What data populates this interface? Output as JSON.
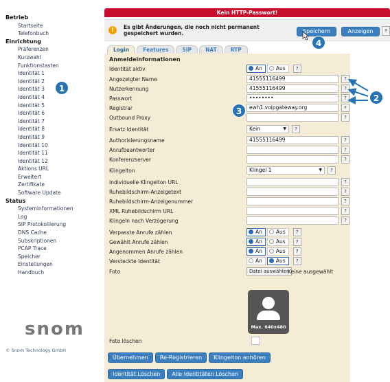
{
  "sidebar": {
    "sections": [
      {
        "title": "Betrieb",
        "items": [
          "Startseite",
          "Telefonbuch"
        ]
      },
      {
        "title": "Einrichtung",
        "items": [
          "Präferenzen",
          "Kurzwahl",
          "Funktionstasten",
          "Identität 1",
          "Identität 2",
          "Identität 3",
          "Identität 4",
          "Identität 5",
          "Identität 6",
          "Identität 7",
          "Identität 8",
          "Identität 9",
          "Identität 10",
          "Identität 11",
          "Identität 12",
          "Aktions URL",
          "Erweitert",
          "Zertifikate",
          "Software Update"
        ]
      },
      {
        "title": "Status",
        "items": [
          "Systeminformationen",
          "Log",
          "SIP Protokollierung",
          "DNS Cache",
          "Subskriptionen",
          "PCAP Trace",
          "Speicher",
          "Einstellungen",
          "Handbuch"
        ]
      }
    ],
    "logo": "snom",
    "copyright": "© Snom Technology GmbH"
  },
  "banner": "Kein HTTP-Passwort!",
  "notice": {
    "icon": "warning-icon",
    "text": "Es gibt Änderungen, die noch nicht permanent gespeichert wurden.",
    "save_label": "Speichern",
    "view_label": "Anzeigen",
    "help": "?"
  },
  "tabs": [
    "Login",
    "Features",
    "SIP",
    "NAT",
    "RTP"
  ],
  "active_tab": "Login",
  "form": {
    "section_title": "Anmeldeinformationen",
    "fields": {
      "identitaet_aktiv": {
        "label": "Identität aktiv",
        "on": "An",
        "off": "Aus",
        "selected": "An"
      },
      "angezeigter_name": {
        "label": "Angezeigter Name",
        "value": "41555116499"
      },
      "nutzerkennung": {
        "label": "Nutzerkennung",
        "value": "41555116499"
      },
      "passwort": {
        "label": "Passwort",
        "value": "••••••••"
      },
      "registrar": {
        "label": "Registrar",
        "value": "ewh1.voipgateway.org"
      },
      "outbound_proxy": {
        "label": "Outbound Proxy",
        "value": ""
      },
      "ersatz_identitaet": {
        "label": "Ersatz Identität",
        "value": "Kein"
      },
      "authorisierungsname": {
        "label": "Authorisierungsname",
        "value": "41555116499"
      },
      "anrufbeantworter": {
        "label": "Anrufbeantworter",
        "value": ""
      },
      "konferenzserver": {
        "label": "Konferenzserver",
        "value": ""
      },
      "klingelton": {
        "label": "Klingelton",
        "value": "Klingel 1"
      },
      "indiv_klingelton_url": {
        "label": "Individuelle Klingelton URL",
        "value": ""
      },
      "ruhebild_anzeigetext": {
        "label": "Ruhebildschirm-Anzeigetext",
        "value": ""
      },
      "ruhebild_anzeigenummer": {
        "label": "Ruhebildschirm-Anzeigenummer",
        "value": ""
      },
      "xml_ruhebild_url": {
        "label": "XML Ruhebildschirm URL",
        "value": ""
      },
      "klingeln_verzoegerung": {
        "label": "Klingeln nach Verzögerung",
        "value": ""
      },
      "verpasste_anrufe": {
        "label": "Verpasste Anrufe zählen",
        "on": "An",
        "off": "Aus",
        "selected": "An"
      },
      "gewaehlt_anrufe": {
        "label": "Gewählt Anrufe zählen",
        "on": "An",
        "off": "Aus",
        "selected": "An"
      },
      "angenommen_anrufe": {
        "label": "Angenommen Anrufe zählen",
        "on": "An",
        "off": "Aus",
        "selected": "An"
      },
      "versteckte_identitaet": {
        "label": "Versteckte Identität",
        "on": "An",
        "off": "Aus",
        "selected": "Aus"
      },
      "foto": {
        "label": "Foto",
        "button": "Datei auswählen",
        "status": "Keine ausgewählt",
        "placeholder_caption": "Max. 640x480"
      },
      "foto_loeschen": {
        "label": "Foto löschen"
      }
    },
    "help": "?",
    "buttons_row1": [
      "Übernehmen",
      "Re-Registrieren",
      "Klingelton anhören"
    ],
    "buttons_row2": [
      "Identität Löschen",
      "Alle Identitäten Löschen"
    ]
  },
  "callouts": [
    "1",
    "2",
    "3",
    "4"
  ],
  "colors": {
    "banner": "#c8102e",
    "accent": "#3c7fbf",
    "panel": "#f4ecd4",
    "callout": "#2673b5"
  }
}
